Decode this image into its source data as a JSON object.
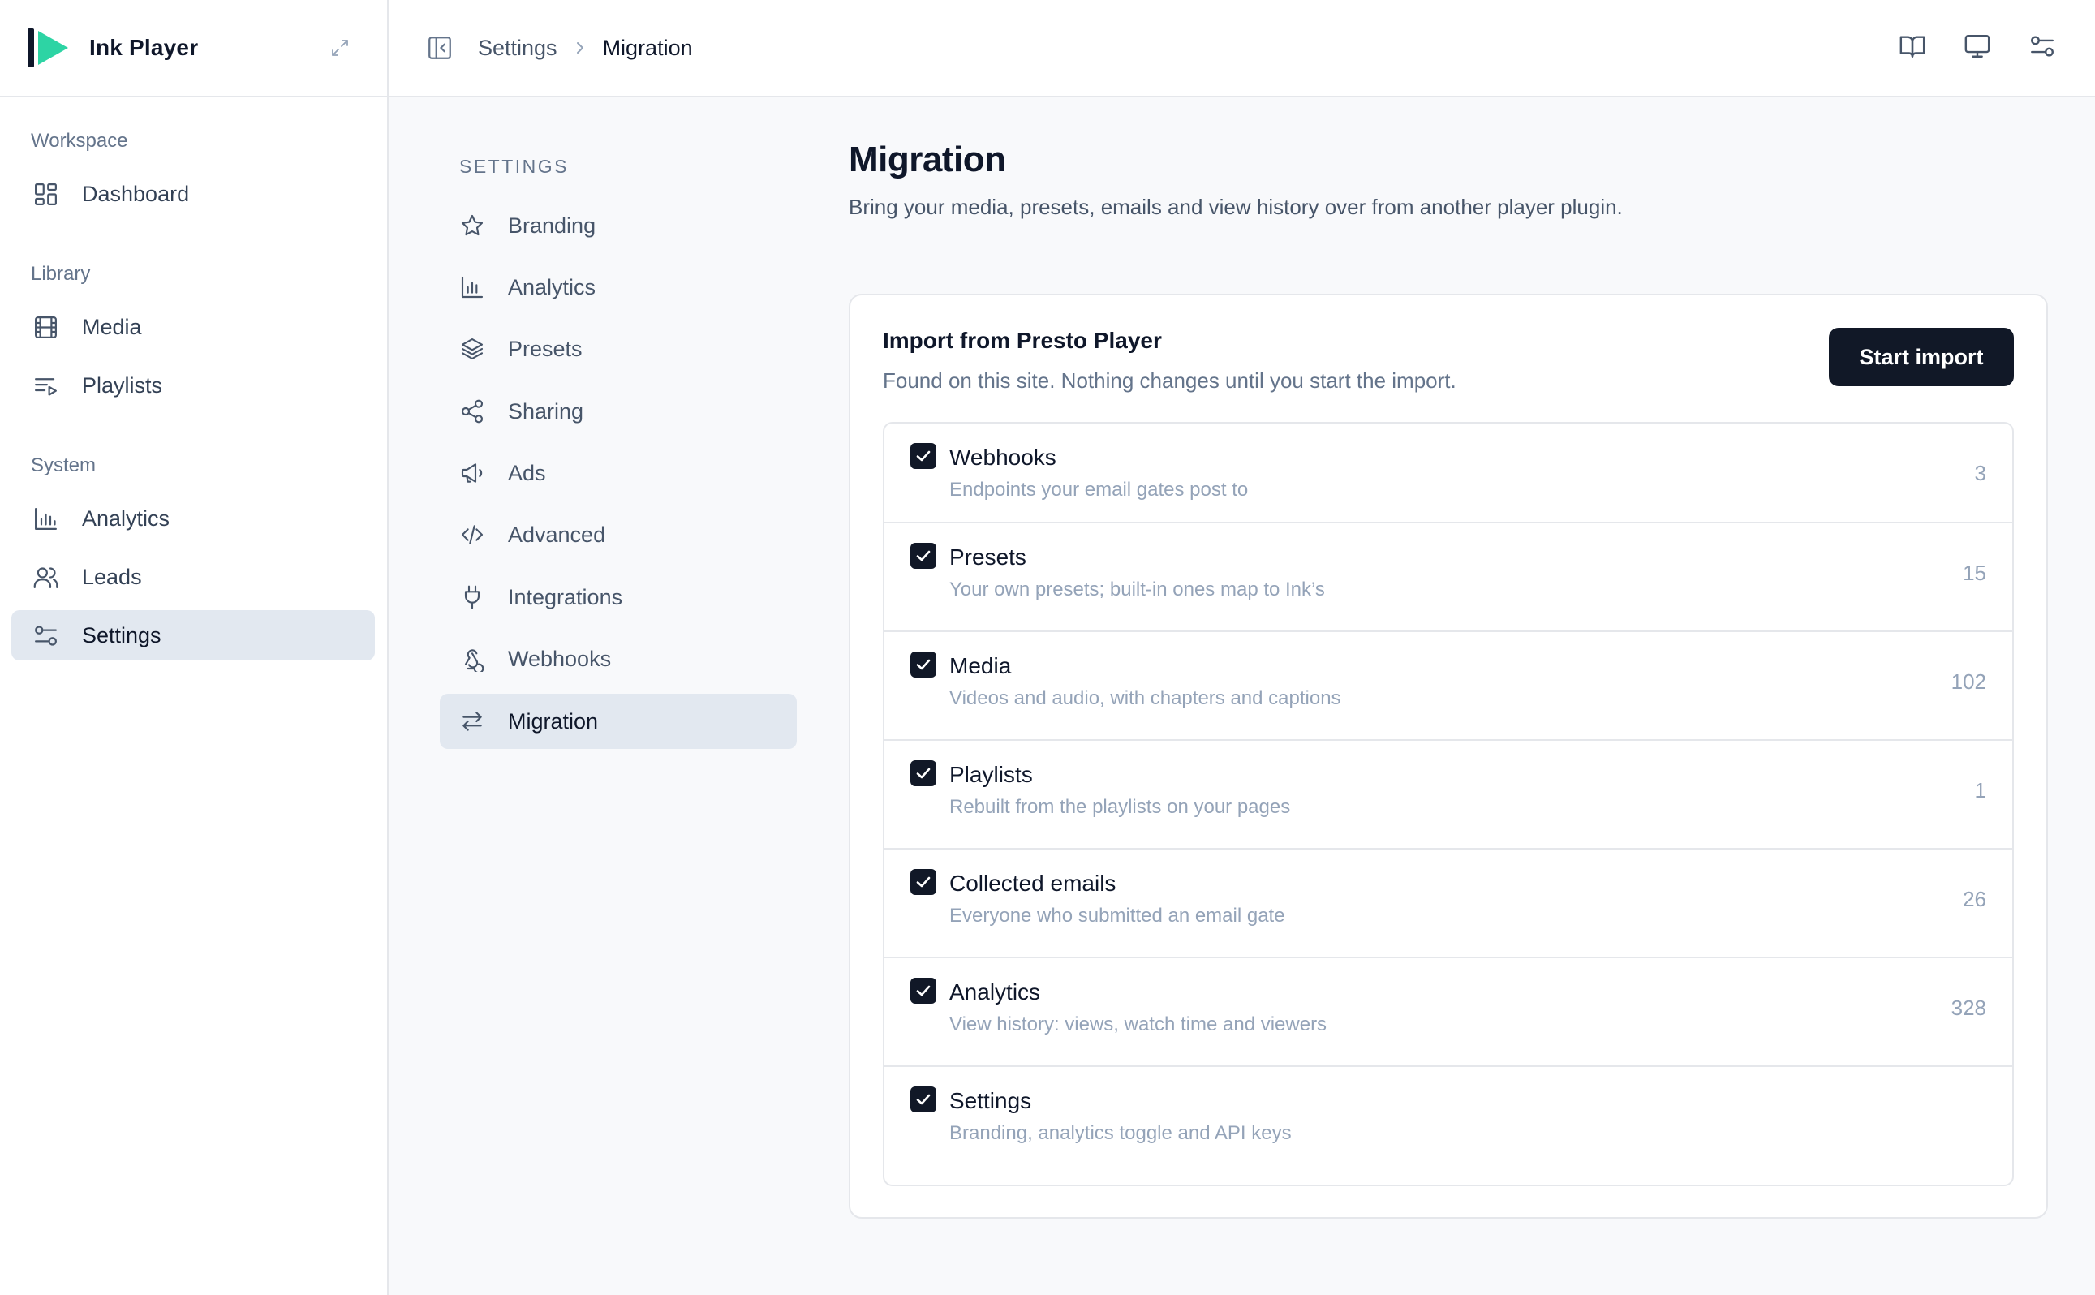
{
  "app": {
    "name": "Ink Player"
  },
  "sidebar": {
    "groups": [
      {
        "label": "Workspace",
        "items": [
          {
            "label": "Dashboard",
            "icon": "dashboard-icon"
          }
        ]
      },
      {
        "label": "Library",
        "items": [
          {
            "label": "Media",
            "icon": "film-icon"
          },
          {
            "label": "Playlists",
            "icon": "playlist-icon"
          }
        ]
      },
      {
        "label": "System",
        "items": [
          {
            "label": "Analytics",
            "icon": "bar-chart-icon"
          },
          {
            "label": "Leads",
            "icon": "users-icon"
          },
          {
            "label": "Settings",
            "icon": "sliders-icon",
            "active": true
          }
        ]
      }
    ]
  },
  "breadcrumb": {
    "parent": "Settings",
    "current": "Migration"
  },
  "settings_nav": {
    "heading": "SETTINGS",
    "items": [
      {
        "label": "Branding",
        "icon": "star-icon"
      },
      {
        "label": "Analytics",
        "icon": "bar-chart-icon"
      },
      {
        "label": "Presets",
        "icon": "layers-icon"
      },
      {
        "label": "Sharing",
        "icon": "share-icon"
      },
      {
        "label": "Ads",
        "icon": "megaphone-icon"
      },
      {
        "label": "Advanced",
        "icon": "code-icon"
      },
      {
        "label": "Integrations",
        "icon": "plug-icon"
      },
      {
        "label": "Webhooks",
        "icon": "webhook-icon"
      },
      {
        "label": "Migration",
        "icon": "arrows-exchange-icon",
        "active": true
      }
    ]
  },
  "page": {
    "title": "Migration",
    "subtitle": "Bring your media, presets, emails and view history over from another player plugin."
  },
  "import_card": {
    "title": "Import from Presto Player",
    "description": "Found on this site. Nothing changes until you start the import.",
    "button_label": "Start import",
    "items": [
      {
        "name": "Webhooks",
        "description": "Endpoints your email gates post to",
        "count": "3",
        "checked": true
      },
      {
        "name": "Presets",
        "description": "Your own presets; built-in ones map to Ink’s",
        "count": "15",
        "checked": true
      },
      {
        "name": "Media",
        "description": "Videos and audio, with chapters and captions",
        "count": "102",
        "checked": true
      },
      {
        "name": "Playlists",
        "description": "Rebuilt from the playlists on your pages",
        "count": "1",
        "checked": true
      },
      {
        "name": "Collected emails",
        "description": "Everyone who submitted an email gate",
        "count": "26",
        "checked": true
      },
      {
        "name": "Analytics",
        "description": "View history: views, watch time and viewers",
        "count": "328",
        "checked": true
      },
      {
        "name": "Settings",
        "description": "Branding, analytics toggle and API keys",
        "count": "",
        "checked": true
      }
    ]
  },
  "colors": {
    "brand_green": "#2dd4a4",
    "brand_dark": "#0f172a",
    "active_bg": "#e2e8f0",
    "button_bg": "#111827"
  }
}
